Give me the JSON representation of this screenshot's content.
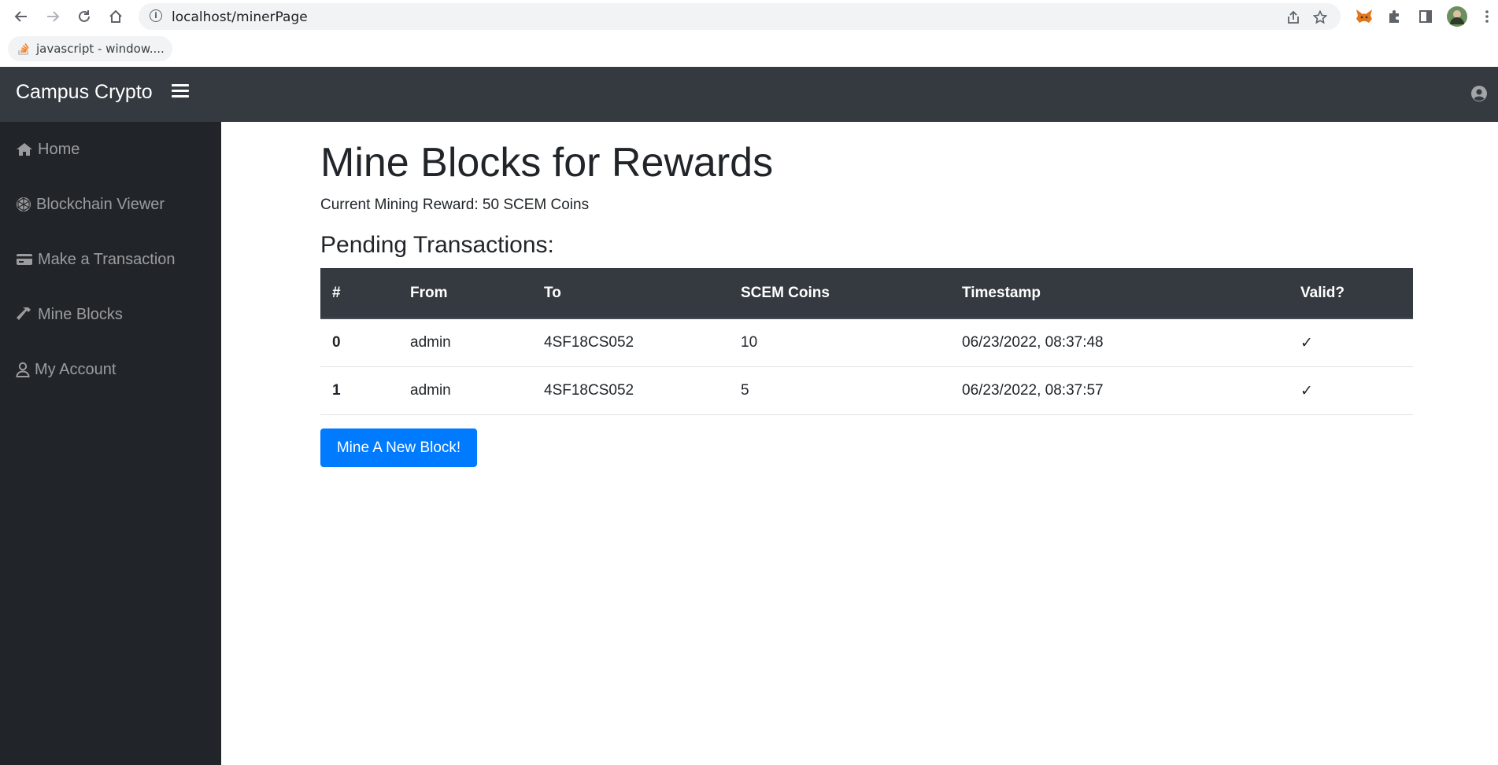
{
  "browser": {
    "url": "localhost/minerPage",
    "bookmark_label": "javascript - window....",
    "back_icon": "arrow-left-icon",
    "forward_icon": "arrow-right-icon",
    "reload_icon": "reload-icon",
    "home_icon": "home-icon"
  },
  "navbar": {
    "brand": "Campus Crypto",
    "toggle_icon": "hamburger-icon",
    "user_icon": "user-circle-icon",
    "background": "#343a40"
  },
  "sidebar": {
    "background": "#212529",
    "items": [
      {
        "label": "Home",
        "icon": "home-icon"
      },
      {
        "label": "Blockchain Viewer",
        "icon": "blockchain-icon"
      },
      {
        "label": "Make a Transaction",
        "icon": "credit-card-icon"
      },
      {
        "label": "Mine Blocks",
        "icon": "hammer-icon"
      },
      {
        "label": "My Account",
        "icon": "user-icon"
      }
    ]
  },
  "main": {
    "title": "Mine Blocks for Rewards",
    "reward_text": "Current Mining Reward: 50 SCEM Coins",
    "pending_title": "Pending Transactions:",
    "table": {
      "headers": [
        "#",
        "From",
        "To",
        "SCEM Coins",
        "Timestamp",
        "Valid?"
      ],
      "rows": [
        {
          "index": "0",
          "from": "admin",
          "to": "4SF18CS052",
          "coins": "10",
          "timestamp": "06/23/2022, 08:37:48",
          "valid": "✓"
        },
        {
          "index": "1",
          "from": "admin",
          "to": "4SF18CS052",
          "coins": "5",
          "timestamp": "06/23/2022, 08:37:57",
          "valid": "✓"
        }
      ]
    },
    "mine_button": "Mine A New Block!",
    "button_color": "#007bff"
  }
}
